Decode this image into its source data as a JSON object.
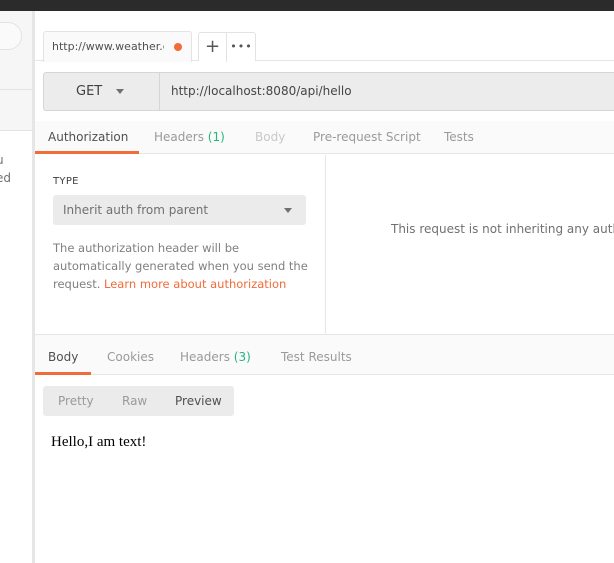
{
  "sidebar": {
    "text_lines": [
      "u",
      "ed"
    ]
  },
  "tabs": {
    "request_tab": {
      "label": "http://www.weather.c",
      "unsaved": true
    },
    "add_label": "+",
    "more_label": "•••"
  },
  "request": {
    "method": "GET",
    "url": "http://localhost:8080/api/hello"
  },
  "request_tabs": [
    {
      "label": "Authorization",
      "count": null,
      "state": "active"
    },
    {
      "label": "Headers",
      "count": "(1)",
      "state": "normal"
    },
    {
      "label": "Body",
      "count": null,
      "state": "disabled"
    },
    {
      "label": "Pre-request Script",
      "count": null,
      "state": "normal"
    },
    {
      "label": "Tests",
      "count": null,
      "state": "normal"
    }
  ],
  "auth": {
    "type_label": "TYPE",
    "type_value": "Inherit auth from parent",
    "help_text": "The authorization header will be automatically generated when you send the request. ",
    "help_link": "Learn more about authorization",
    "message": "This request is not inheriting any authorization helper at the moment. Save it in a collection to use the parent's authorization helper."
  },
  "response_tabs": [
    {
      "label": "Body",
      "count": null,
      "state": "active"
    },
    {
      "label": "Cookies",
      "count": null,
      "state": "normal"
    },
    {
      "label": "Headers",
      "count": "(3)",
      "state": "normal"
    },
    {
      "label": "Test Results",
      "count": null,
      "state": "normal"
    }
  ],
  "response": {
    "views": [
      {
        "label": "Pretty",
        "state": "normal"
      },
      {
        "label": "Raw",
        "state": "normal"
      },
      {
        "label": "Preview",
        "state": "active"
      }
    ],
    "preview_text": "Hello,I am text!"
  },
  "colors": {
    "accent": "#f26b3a",
    "count_green": "#26b47f"
  }
}
